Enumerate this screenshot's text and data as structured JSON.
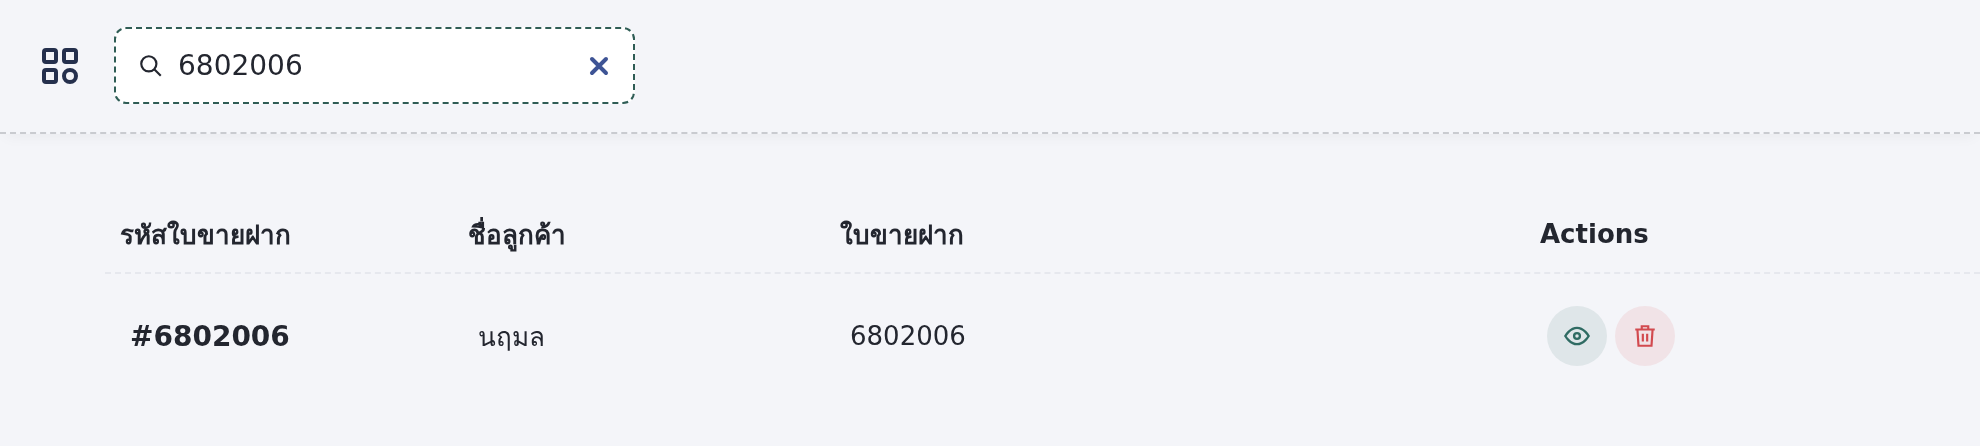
{
  "search": {
    "value": "6802006"
  },
  "table": {
    "columns": [
      "รหัสใบขายฝาก",
      "ชื่อลูกค้า",
      "ใบขายฝาก",
      "Actions"
    ],
    "rows": [
      {
        "code": "#6802006",
        "customer": "นฤมล",
        "contract": "6802006",
        "actions": [
          {
            "kind": "view"
          },
          {
            "kind": "delete"
          }
        ]
      }
    ]
  }
}
